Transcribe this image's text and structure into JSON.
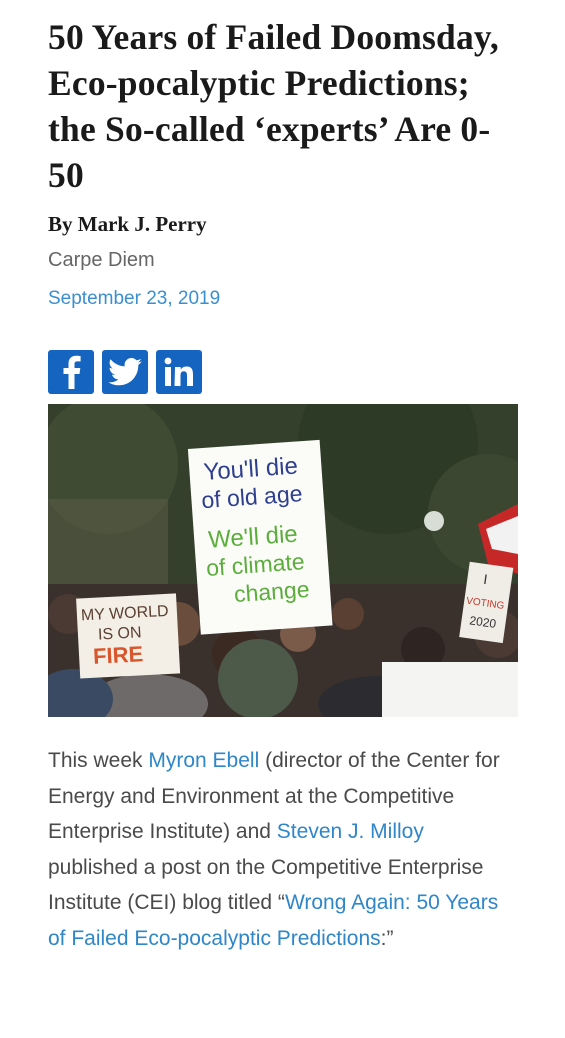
{
  "article": {
    "title": "50 Years of Failed Doomsday, Eco-pocalyptic Predictions; the So-called ‘experts’ Are 0-50",
    "byline": "By Mark J. Perry",
    "source": "Carpe Diem",
    "date": "September 23, 2019"
  },
  "social": {
    "facebook_icon": "facebook-icon",
    "twitter_icon": "twitter-icon",
    "linkedin_icon": "linkedin-icon",
    "brand_color": "#1565c0"
  },
  "photo": {
    "sign_main_line1": "You'll die",
    "sign_main_line2": "of old age",
    "sign_main_line3": "We'll die",
    "sign_main_line4": "of climate",
    "sign_main_line5": "change",
    "sign_left_line1": "MY WORLD",
    "sign_left_line2": "IS ON",
    "sign_left_line3": "FIRE",
    "sign_right_line1": "I",
    "sign_right_line2": "VOTING",
    "sign_right_line3": "2020"
  },
  "body": {
    "p1_a": "This week ",
    "link1": "Myron Ebell",
    "p1_b": " (director of the Center for Energy and Environment at the Competitive Enterprise Institute) and ",
    "link2": "Steven J. Milloy",
    "p1_c": " published a post on the Competitive Enterprise Institute (CEI) blog titled “",
    "link3": "Wrong Again: 50 Years of Failed Eco-pocalyptic Predictions",
    "p1_d": ":”"
  },
  "colors": {
    "link": "#2f86c9",
    "date": "#3a8fd0"
  }
}
